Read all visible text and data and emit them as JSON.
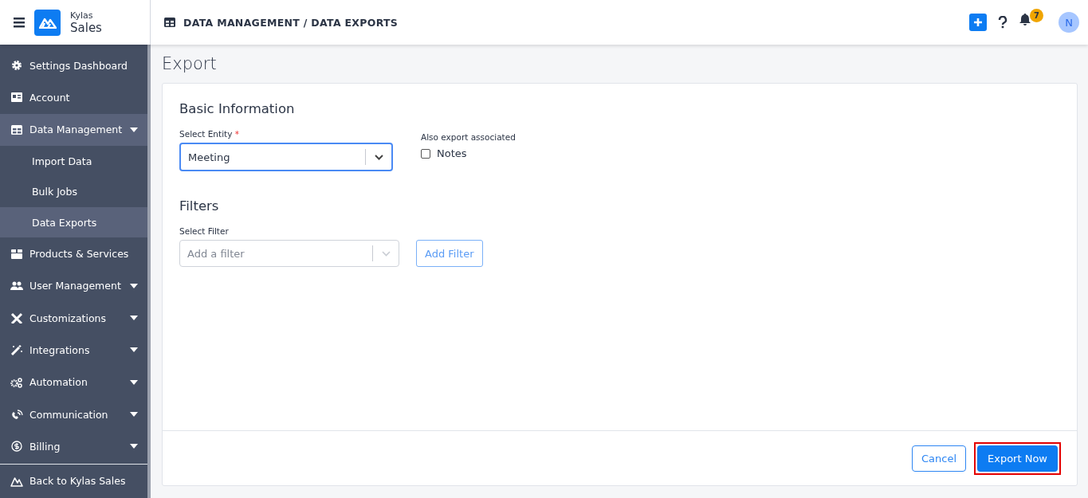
{
  "header": {
    "brand_top": "Kylas",
    "brand_bottom": "Sales",
    "breadcrumb": "DATA MANAGEMENT / DATA EXPORTS",
    "notification_count": "7",
    "avatar_initial": "N"
  },
  "sidebar": {
    "items": [
      {
        "label": "Settings Dashboard"
      },
      {
        "label": "Account"
      },
      {
        "label": "Data Management",
        "expanded": true,
        "children": [
          {
            "label": "Import Data",
            "selected": false
          },
          {
            "label": "Bulk Jobs",
            "selected": false
          },
          {
            "label": "Data Exports",
            "selected": true
          }
        ]
      },
      {
        "label": "Products & Services"
      },
      {
        "label": "User Management",
        "expanded": false
      },
      {
        "label": "Customizations",
        "expanded": false
      },
      {
        "label": "Integrations",
        "expanded": false
      },
      {
        "label": "Automation",
        "expanded": false
      },
      {
        "label": "Communication",
        "expanded": false
      },
      {
        "label": "Billing",
        "expanded": false
      }
    ],
    "footer_link": "Back to Kylas Sales"
  },
  "page": {
    "title": "Export",
    "basic_information": {
      "heading": "Basic Information",
      "entity_label": "Select Entity",
      "required_mark": "*",
      "entity_value": "Meeting",
      "associated_label": "Also export associated",
      "notes": {
        "label": "Notes",
        "checked": false
      }
    },
    "filters": {
      "heading": "Filters",
      "filter_label": "Select Filter",
      "placeholder": "Add a filter",
      "add_button": "Add Filter"
    },
    "buttons": [
      {
        "label": "Cancel",
        "kind": "secondary",
        "highlighted": false
      },
      {
        "label": "Export Now",
        "kind": "primary",
        "highlighted": true
      }
    ]
  }
}
